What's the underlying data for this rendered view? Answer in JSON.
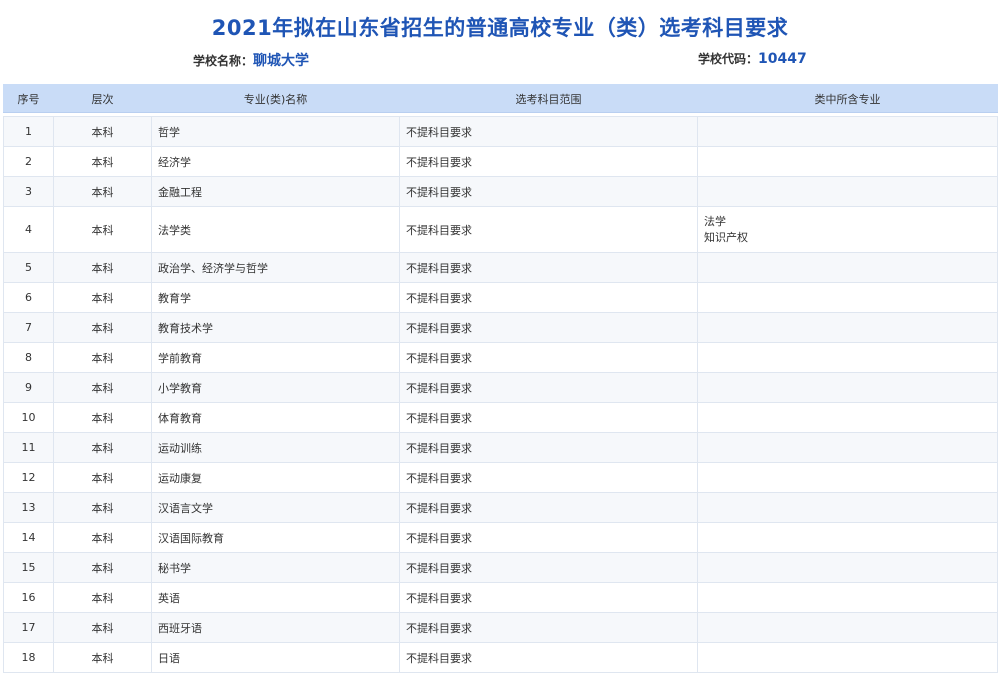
{
  "title": "2021年拟在山东省招生的普通高校专业（类）选考科目要求",
  "school": {
    "name_label": "学校名称：",
    "name_value": "聊城大学",
    "code_label": "学校代码：",
    "code_value": "10447"
  },
  "table": {
    "headers": [
      "序号",
      "层次",
      "专业(类)名称",
      "选考科目范围",
      "类中所含专业"
    ],
    "rows": [
      {
        "no": "1",
        "level": "本科",
        "major": "哲学",
        "req": "不提科目要求",
        "sub": []
      },
      {
        "no": "2",
        "level": "本科",
        "major": "经济学",
        "req": "不提科目要求",
        "sub": []
      },
      {
        "no": "3",
        "level": "本科",
        "major": "金融工程",
        "req": "不提科目要求",
        "sub": []
      },
      {
        "no": "4",
        "level": "本科",
        "major": "法学类",
        "req": "不提科目要求",
        "sub": [
          "法学",
          "知识产权"
        ]
      },
      {
        "no": "5",
        "level": "本科",
        "major": "政治学、经济学与哲学",
        "req": "不提科目要求",
        "sub": []
      },
      {
        "no": "6",
        "level": "本科",
        "major": "教育学",
        "req": "不提科目要求",
        "sub": []
      },
      {
        "no": "7",
        "level": "本科",
        "major": "教育技术学",
        "req": "不提科目要求",
        "sub": []
      },
      {
        "no": "8",
        "level": "本科",
        "major": "学前教育",
        "req": "不提科目要求",
        "sub": []
      },
      {
        "no": "9",
        "level": "本科",
        "major": "小学教育",
        "req": "不提科目要求",
        "sub": []
      },
      {
        "no": "10",
        "level": "本科",
        "major": "体育教育",
        "req": "不提科目要求",
        "sub": []
      },
      {
        "no": "11",
        "level": "本科",
        "major": "运动训练",
        "req": "不提科目要求",
        "sub": []
      },
      {
        "no": "12",
        "level": "本科",
        "major": "运动康复",
        "req": "不提科目要求",
        "sub": []
      },
      {
        "no": "13",
        "level": "本科",
        "major": "汉语言文学",
        "req": "不提科目要求",
        "sub": []
      },
      {
        "no": "14",
        "level": "本科",
        "major": "汉语国际教育",
        "req": "不提科目要求",
        "sub": []
      },
      {
        "no": "15",
        "level": "本科",
        "major": "秘书学",
        "req": "不提科目要求",
        "sub": []
      },
      {
        "no": "16",
        "level": "本科",
        "major": "英语",
        "req": "不提科目要求",
        "sub": []
      },
      {
        "no": "17",
        "level": "本科",
        "major": "西班牙语",
        "req": "不提科目要求",
        "sub": []
      },
      {
        "no": "18",
        "level": "本科",
        "major": "日语",
        "req": "不提科目要求",
        "sub": []
      }
    ]
  }
}
